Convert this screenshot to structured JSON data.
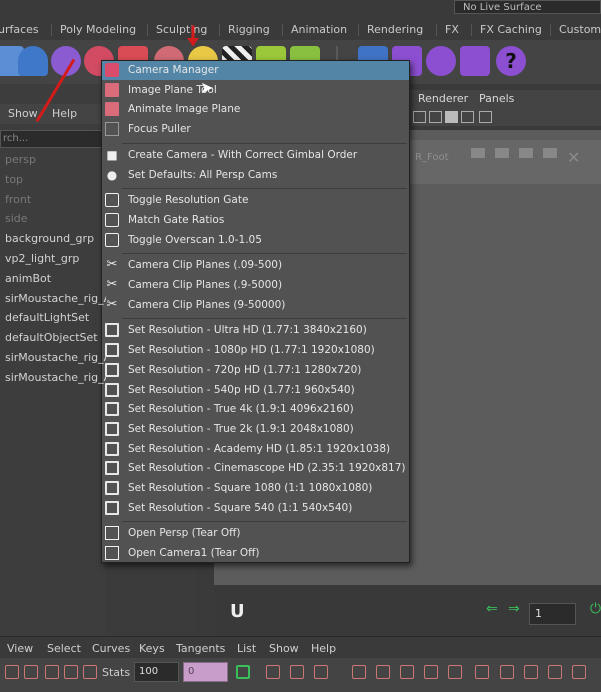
{
  "shelf": {
    "tabs": [
      "urfaces",
      "Poly Modeling",
      "Sculpting",
      "Rigging",
      "Animation",
      "Rendering",
      "FX",
      "FX Caching",
      "Custom"
    ],
    "live_surface": "No Live Surface"
  },
  "outliner": {
    "menu": [
      "Show",
      "Help"
    ],
    "search_placeholder": "rch...",
    "items": [
      {
        "label": "persp",
        "dim": true
      },
      {
        "label": "top",
        "dim": true
      },
      {
        "label": "front",
        "dim": true
      },
      {
        "label": "side",
        "dim": true
      },
      {
        "label": "background_grp",
        "dim": false
      },
      {
        "label": "vp2_light_grp",
        "dim": false
      },
      {
        "label": "animBot",
        "dim": false
      },
      {
        "label": "sirMoustache_rig_A",
        "dim": false
      },
      {
        "label": "defaultLightSet",
        "dim": false
      },
      {
        "label": "defaultObjectSet",
        "dim": false
      },
      {
        "label": "sirMoustache_rig_A",
        "dim": false
      },
      {
        "label": "sirMoustache_rig_A",
        "dim": false
      }
    ]
  },
  "viewport": {
    "menu": [
      "Renderer",
      "Panels"
    ],
    "label": "R_Foot",
    "frame_value": "1"
  },
  "menu": {
    "items": [
      {
        "label": "Camera Manager",
        "icon": "camera-icon",
        "highlighted": true
      },
      {
        "label": "Image Plane Tool",
        "icon": "image-plane-icon"
      },
      {
        "label": "Animate Image Plane",
        "icon": "image-plane-icon"
      },
      {
        "label": "Focus Puller",
        "icon": "focus-icon"
      },
      {
        "label": "Create Camera - With Correct Gimbal Order",
        "icon": "movie-camera-icon",
        "sep_before": true
      },
      {
        "label": "Set Defaults: All Persp Cams",
        "icon": "camera-settings-icon"
      },
      {
        "label": "Toggle Resolution Gate",
        "icon": "gate-icon",
        "sep_before": true
      },
      {
        "label": "Match Gate Ratios",
        "icon": "gate-icon"
      },
      {
        "label": "Toggle Overscan 1.0-1.05",
        "icon": "gate-icon"
      },
      {
        "label": "Camera Clip Planes (.09-500)",
        "icon": "scissors-icon",
        "sep_before": true
      },
      {
        "label": "Camera Clip Planes (.9-5000)",
        "icon": "scissors-icon"
      },
      {
        "label": "Camera Clip Planes (9-50000)",
        "icon": "scissors-icon"
      },
      {
        "label": "Set Resolution  - Ultra HD (1.77:1 3840x2160)",
        "icon": "resolution-icon",
        "sep_before": true
      },
      {
        "label": "Set Resolution  - 1080p HD (1.77:1 1920x1080)",
        "icon": "resolution-icon"
      },
      {
        "label": "Set Resolution  - 720p HD (1.77:1 1280x720)",
        "icon": "resolution-icon"
      },
      {
        "label": "Set Resolution  - 540p HD (1.77:1 960x540)",
        "icon": "resolution-icon"
      },
      {
        "label": "Set Resolution  - True 4k (1.9:1 4096x2160)",
        "icon": "resolution-icon"
      },
      {
        "label": "Set Resolution  - True 2k (1.9:1 2048x1080)",
        "icon": "resolution-icon"
      },
      {
        "label": "Set Resolution  - Academy HD (1.85:1 1920x1038)",
        "icon": "resolution-icon"
      },
      {
        "label": "Set Resolution  - Cinemascope HD (2.35:1 1920x817)",
        "icon": "resolution-icon"
      },
      {
        "label": "Set Resolution  - Square 1080 (1:1 1080x1080)",
        "icon": "resolution-icon"
      },
      {
        "label": "Set Resolution  - Square 540 (1:1 540x540)",
        "icon": "resolution-icon"
      },
      {
        "label": "Open Persp (Tear Off)",
        "icon": "tearoff-icon",
        "sep_before": true
      },
      {
        "label": "Open Camera1 (Tear Off)",
        "icon": "tearoff-icon"
      }
    ]
  },
  "graph_editor": {
    "menu": [
      "View",
      "Select",
      "Curves",
      "Keys",
      "Tangents",
      "List",
      "Show",
      "Help"
    ],
    "stats_label": "Stats",
    "stats_value": "100",
    "second_value": "0"
  },
  "colors": {
    "highlight": "#5285a6",
    "annotation_arrow": "#d41b1b"
  }
}
